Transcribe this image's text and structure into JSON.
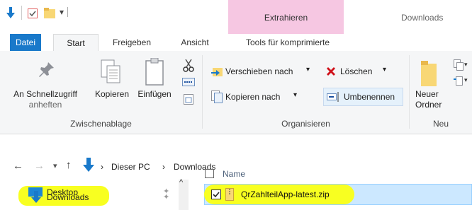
{
  "title_bar": {
    "context_tab_label": "Extrahieren",
    "window_title": "Downloads"
  },
  "tabs": [
    {
      "label": "Datei"
    },
    {
      "label": "Start"
    },
    {
      "label": "Freigeben"
    },
    {
      "label": "Ansicht"
    },
    {
      "label": "Tools für komprimierte Ordner"
    }
  ],
  "ribbon": {
    "zwischenablage": {
      "label": "Zwischenablage",
      "pin_label_1": "An Schnellzugriff",
      "pin_label_2": "anheften",
      "copy_label": "Kopieren",
      "paste_label": "Einfügen"
    },
    "organisieren": {
      "label": "Organisieren",
      "move_to": "Verschieben nach",
      "copy_to": "Kopieren nach",
      "delete": "Löschen",
      "rename": "Umbenennen"
    },
    "neu": {
      "label": "Neu",
      "new_folder_1": "Neuer",
      "new_folder_2": "Ordner"
    }
  },
  "address": {
    "crumb_1": "Dieser PC",
    "crumb_2": "Downloads"
  },
  "nav_pane": {
    "items": [
      {
        "label": "Desktop"
      },
      {
        "label": "Downloads"
      }
    ]
  },
  "file_list": {
    "column_name": "Name",
    "rows": [
      {
        "name": "QrZahlteilApp-latest.zip",
        "selected": true
      }
    ]
  },
  "colors": {
    "accent": "#1979ca",
    "context_tab": "#f6c7e2",
    "selection": "#cce8ff",
    "highlight": "#f8ff21"
  }
}
